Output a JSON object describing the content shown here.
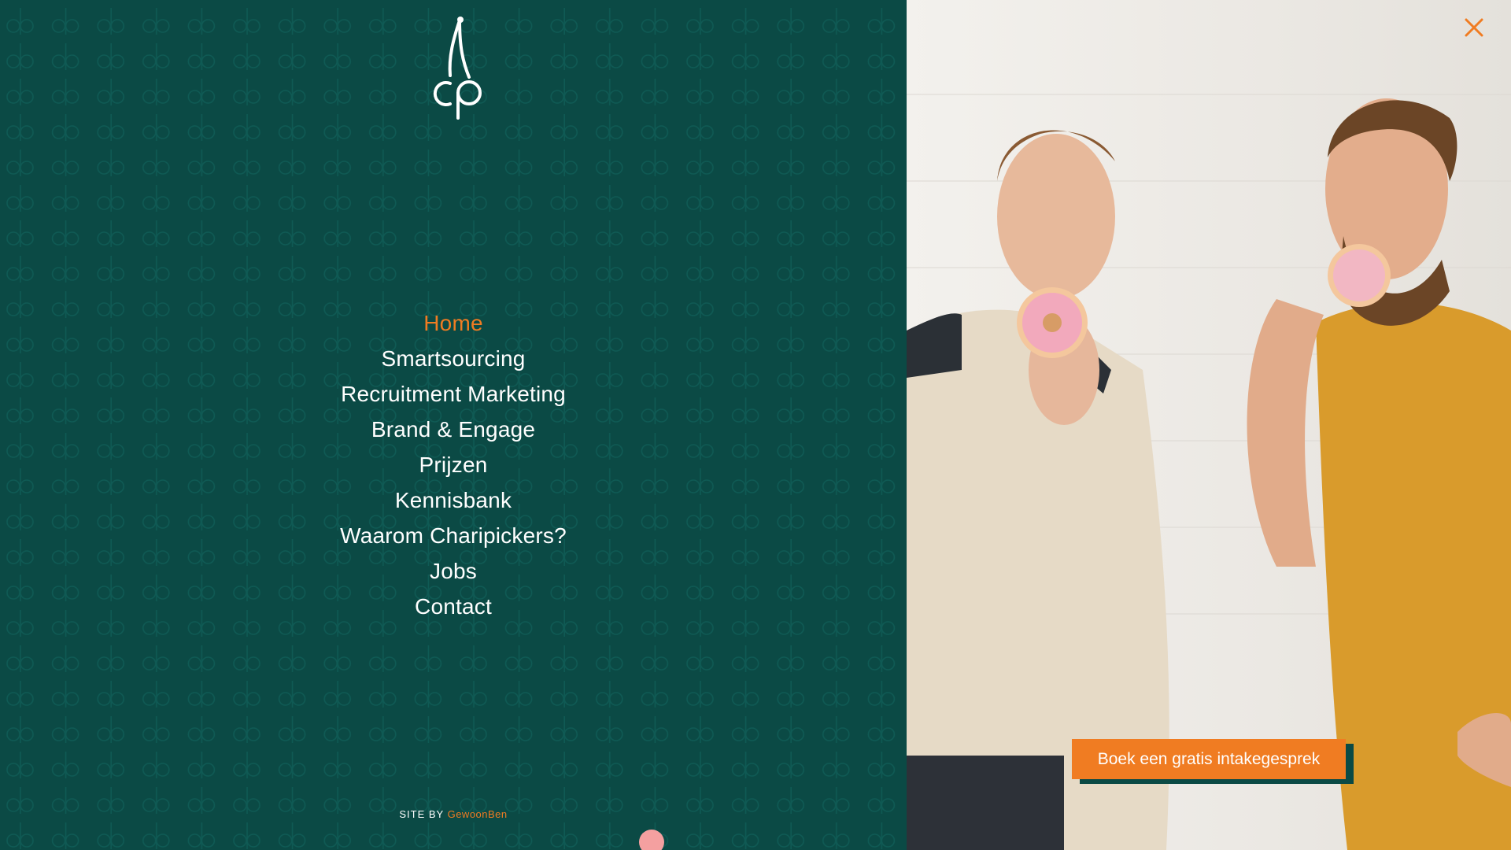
{
  "brand": {
    "logo_text": "cp",
    "accent_color": "#f07c22",
    "panel_color": "#0b4a45"
  },
  "menu": {
    "items": [
      {
        "label": "Home",
        "active": true
      },
      {
        "label": "Smartsourcing",
        "active": false
      },
      {
        "label": "Recruitment Marketing",
        "active": false
      },
      {
        "label": "Brand & Engage",
        "active": false
      },
      {
        "label": "Prijzen",
        "active": false
      },
      {
        "label": "Kennisbank",
        "active": false
      },
      {
        "label": "Waarom Charipickers?",
        "active": false
      },
      {
        "label": "Jobs",
        "active": false
      },
      {
        "label": "Contact",
        "active": false
      }
    ]
  },
  "footer": {
    "site_by": "SITE BY",
    "credit": "GewoonBen"
  },
  "header": {
    "close_icon": "close-icon"
  },
  "cta": {
    "label": "Boek een gratis intakegesprek"
  }
}
